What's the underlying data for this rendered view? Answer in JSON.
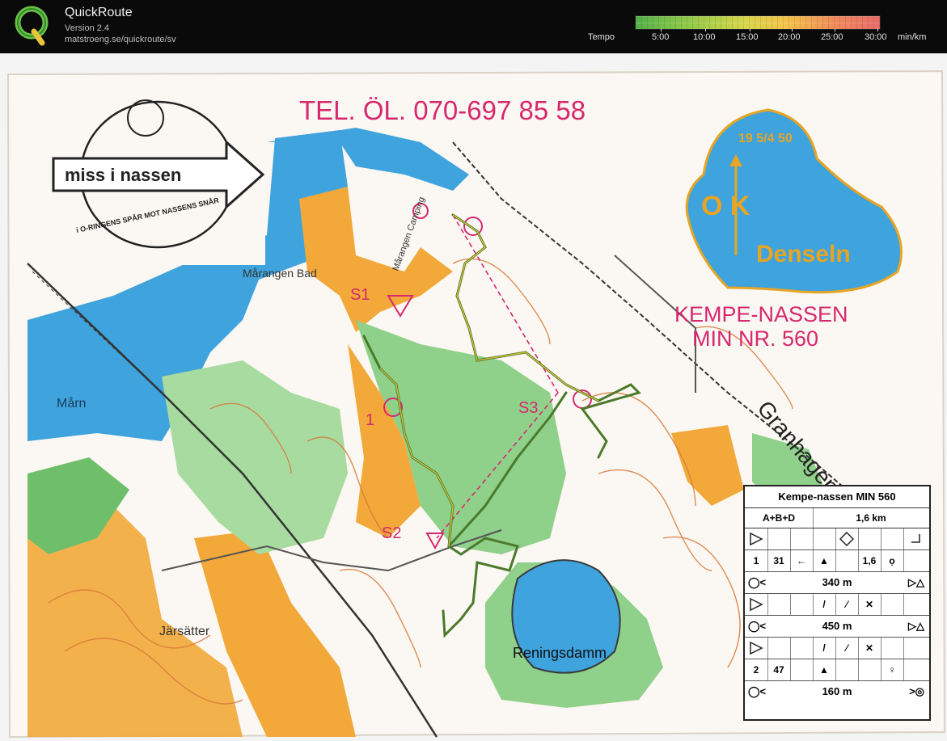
{
  "app": {
    "title": "QuickRoute",
    "version": "Version 2.4",
    "url": "matstroeng.se/quickroute/sv"
  },
  "tempo": {
    "label": "Tempo",
    "ticks": [
      "5:00",
      "10:00",
      "15:00",
      "20:00",
      "25:00",
      "30:00"
    ],
    "unit": "min/km"
  },
  "map": {
    "phone": "TEL. ÖL. 070-697 85 58",
    "event_line1": "KEMPE-NASSEN",
    "event_line2": "MIN NR. 560",
    "club_name": "Denseln",
    "club_ok": "O K",
    "club_year": "19 5/4 50",
    "logo_text": "miss i nassen",
    "logo_sub": "i O-RINGENS SPÅR MOT NASSENS SNÅR",
    "labels": {
      "marangen_bad": "Mårangen Bad",
      "marn": "Mårn",
      "camping": "Mårangen Camping",
      "granhagen": "Granhagen",
      "jarsatter": "Järsätter",
      "reningsdamm": "Reningsdamm",
      "s1": "S1",
      "s2": "S2",
      "s3": "S3",
      "c1": "1"
    }
  },
  "description": {
    "title": "Kempe-nassen MIN 560",
    "course": "A+B+D",
    "length": "1,6 km",
    "row1_num": "1",
    "row1_code": "31",
    "row1_dim": "1,6",
    "leg1": "340 m",
    "leg2": "450 m",
    "row2_num": "2",
    "row2_code": "47",
    "leg3": "160 m"
  },
  "colors": {
    "header_bg": "#0a0a0a",
    "water": "#3fa3dd",
    "forest_green": "#8fd08a",
    "open_yellow": "#f2a93a",
    "magenta": "#d6286e",
    "route": "#4a7a2a"
  }
}
